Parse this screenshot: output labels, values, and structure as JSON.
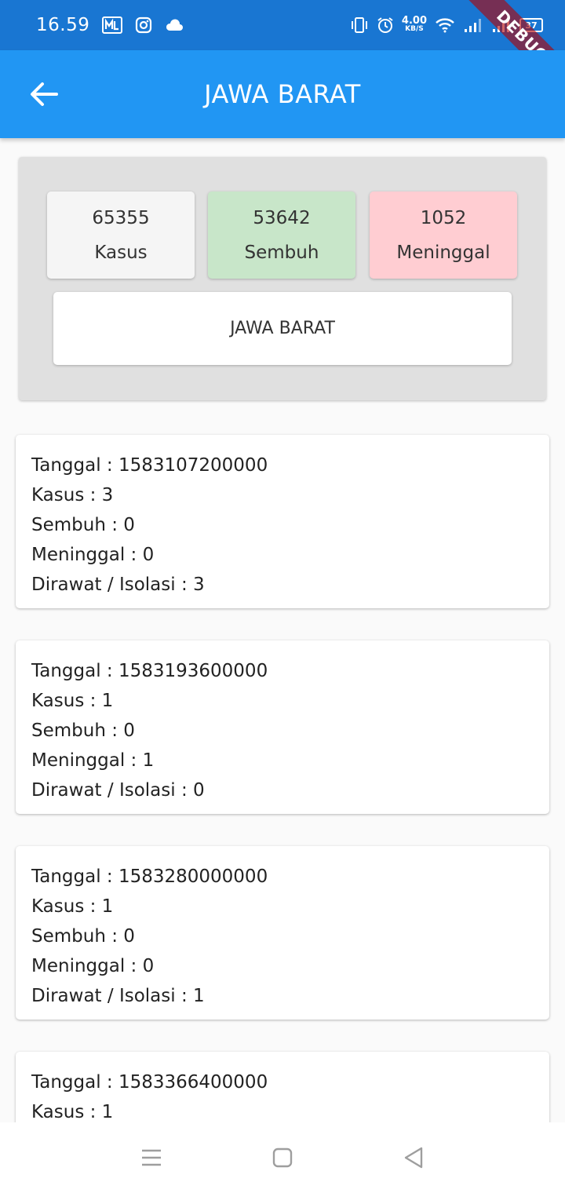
{
  "status_bar": {
    "time": "16.59",
    "net_speed_value": "4.00",
    "net_speed_unit": "KB/S",
    "battery": "37",
    "icons": [
      "ml-app-icon",
      "instagram-icon",
      "cloud-icon",
      "vibrate-icon",
      "alarm-icon",
      "wifi-icon",
      "signal-icon",
      "signal-icon",
      "battery-icon"
    ]
  },
  "debug_banner": "DEBUG",
  "app_bar": {
    "title": "JAWA BARAT",
    "back_icon": "arrow-back-icon"
  },
  "summary": {
    "kasus": {
      "value": "65355",
      "label": "Kasus",
      "color": "#f5f5f5"
    },
    "sembuh": {
      "value": "53642",
      "label": "Sembuh",
      "color": "#c8e6c9"
    },
    "meninggal": {
      "value": "1052",
      "label": "Meninggal",
      "color": "#ffcdd2"
    },
    "region_button": "JAWA BARAT"
  },
  "records": [
    {
      "tanggal": "Tanggal : 1583107200000",
      "kasus": "Kasus : 3",
      "sembuh": "Sembuh : 0",
      "meninggal": "Meninggal : 0",
      "dirawat": "Dirawat / Isolasi : 3"
    },
    {
      "tanggal": "Tanggal : 1583193600000",
      "kasus": "Kasus : 1",
      "sembuh": "Sembuh : 0",
      "meninggal": "Meninggal : 1",
      "dirawat": "Dirawat / Isolasi : 0"
    },
    {
      "tanggal": "Tanggal : 1583280000000",
      "kasus": "Kasus : 1",
      "sembuh": "Sembuh : 0",
      "meninggal": "Meninggal : 0",
      "dirawat": "Dirawat / Isolasi : 1"
    },
    {
      "tanggal": "Tanggal : 1583366400000",
      "kasus": "Kasus : 1",
      "sembuh": "",
      "meninggal": "",
      "dirawat": ""
    }
  ],
  "colors": {
    "status_bar": "#1976d2",
    "app_bar": "#2196f3",
    "panel": "#e0e0e0"
  }
}
